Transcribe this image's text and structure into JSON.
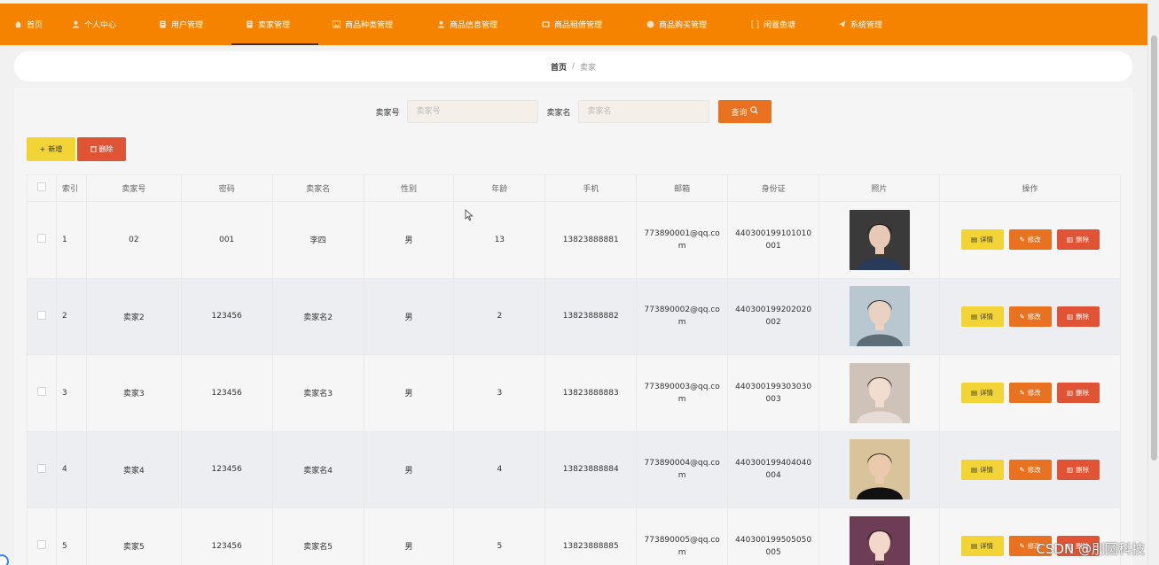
{
  "nav": {
    "items": [
      {
        "label": "首页",
        "icon": "home-icon"
      },
      {
        "label": "个人中心",
        "icon": "user-icon"
      },
      {
        "label": "用户管理",
        "icon": "document-icon"
      },
      {
        "label": "卖家管理",
        "icon": "document-icon",
        "active": true
      },
      {
        "label": "商品种类管理",
        "icon": "image-icon"
      },
      {
        "label": "商品信息管理",
        "icon": "user-icon"
      },
      {
        "label": "商品租借管理",
        "icon": "film-icon"
      },
      {
        "label": "商品购买管理",
        "icon": "globe-icon"
      },
      {
        "label": "闲置鱼塘",
        "icon": "bracket-icon"
      },
      {
        "label": "系统管理",
        "icon": "send-icon"
      }
    ]
  },
  "breadcrumb": {
    "home": "首页",
    "separator": "/",
    "current": "卖家"
  },
  "search": {
    "seller_no_label": "卖家号",
    "seller_no_placeholder": "卖家号",
    "seller_name_label": "卖家名",
    "seller_name_placeholder": "卖家名",
    "button_label": "查询"
  },
  "actions": {
    "add_label": "新增",
    "delete_label": "删除"
  },
  "table": {
    "headers": [
      "",
      "索引",
      "卖家号",
      "密码",
      "卖家名",
      "性别",
      "年龄",
      "手机",
      "邮箱",
      "身份证",
      "照片",
      "操作"
    ],
    "op_labels": {
      "detail": "详情",
      "edit": "修改",
      "delete": "删除"
    },
    "rows": [
      {
        "index": "1",
        "seller_no": "02",
        "password": "001",
        "name": "李四",
        "gender": "男",
        "age": "13",
        "phone": "13823888881",
        "email": "773890001@qq.com",
        "id_card": "440300199101010001"
      },
      {
        "index": "2",
        "seller_no": "卖家2",
        "password": "123456",
        "name": "卖家名2",
        "gender": "男",
        "age": "2",
        "phone": "13823888882",
        "email": "773890002@qq.com",
        "id_card": "440300199202020002"
      },
      {
        "index": "3",
        "seller_no": "卖家3",
        "password": "123456",
        "name": "卖家名3",
        "gender": "男",
        "age": "3",
        "phone": "13823888883",
        "email": "773890003@qq.com",
        "id_card": "440300199303030003"
      },
      {
        "index": "4",
        "seller_no": "卖家4",
        "password": "123456",
        "name": "卖家名4",
        "gender": "男",
        "age": "4",
        "phone": "13823888884",
        "email": "773890004@qq.com",
        "id_card": "440300199404040004"
      },
      {
        "index": "5",
        "seller_no": "卖家5",
        "password": "123456",
        "name": "卖家名5",
        "gender": "男",
        "age": "5",
        "phone": "13823888885",
        "email": "773890005@qq.com",
        "id_card": "440300199505050005"
      }
    ]
  },
  "watermark": "CSDN @刖圆科技",
  "colors": {
    "nav_bg": "#f58300",
    "yellow": "#f2d437",
    "orange": "#e8721f",
    "red": "#e05335"
  }
}
